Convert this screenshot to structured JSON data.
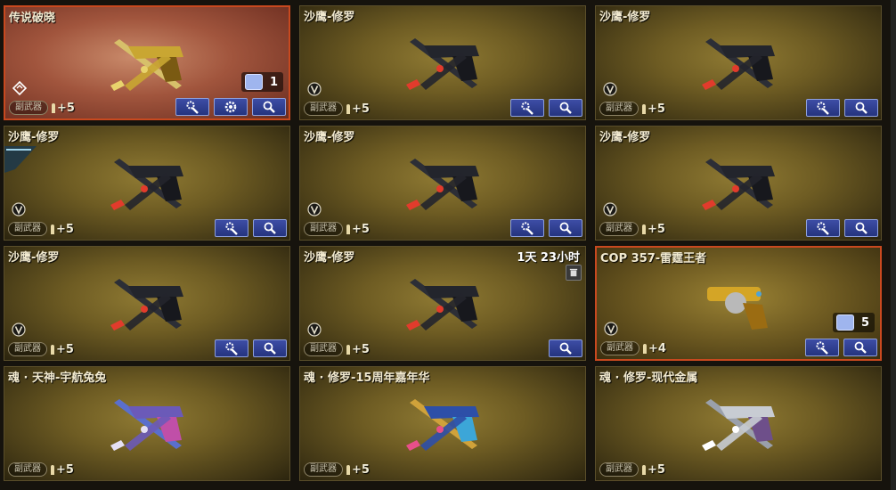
{
  "labels": {
    "category": "副武器"
  },
  "colors": {
    "rare_border": "#c8491f",
    "button_blue": "#3d4da5",
    "card_gold": "#8f7a33"
  },
  "icons": {
    "rank": "v-rank-icon",
    "upgrade": "wrench-gear-icon",
    "settings": "gear-icon",
    "inspect": "magnifier-icon"
  },
  "items": [
    {
      "name": "传说破晓",
      "ammo": "+5",
      "rare": true,
      "tint": "red",
      "rank": "diamond",
      "count": "1",
      "buttons": [
        "upgrade",
        "settings",
        "inspect"
      ],
      "weapon": "gold-eagle"
    },
    {
      "name": "沙鹰-修罗",
      "ammo": "+5",
      "rank": "v",
      "buttons": [
        "upgrade",
        "inspect"
      ],
      "weapon": "dark-eagle"
    },
    {
      "name": "沙鹰-修罗",
      "ammo": "+5",
      "rank": "v",
      "buttons": [
        "upgrade",
        "inspect"
      ],
      "weapon": "dark-eagle"
    },
    {
      "name": "沙鹰-修罗",
      "ammo": "+5",
      "rank": "v",
      "cfs": true,
      "buttons": [
        "upgrade",
        "inspect"
      ],
      "weapon": "dark-eagle"
    },
    {
      "name": "沙鹰-修罗",
      "ammo": "+5",
      "rank": "v",
      "buttons": [
        "upgrade",
        "inspect"
      ],
      "weapon": "dark-eagle"
    },
    {
      "name": "沙鹰-修罗",
      "ammo": "+5",
      "rank": "v",
      "buttons": [
        "upgrade",
        "inspect"
      ],
      "weapon": "dark-eagle"
    },
    {
      "name": "沙鹰-修罗",
      "ammo": "+5",
      "rank": "v",
      "buttons": [
        "upgrade",
        "inspect"
      ],
      "weapon": "dark-eagle"
    },
    {
      "name": "沙鹰-修罗",
      "ammo": "+5",
      "rank": "v",
      "timer": "1天 23小时",
      "trash": true,
      "buttons": [
        "inspect"
      ],
      "weapon": "dark-eagle"
    },
    {
      "name": "COP 357-雷霆王者",
      "ammo": "+4",
      "rare": true,
      "tint": "gold",
      "rank": "v",
      "count": "5",
      "buttons": [
        "upgrade",
        "inspect"
      ],
      "weapon": "gold-revolver"
    },
    {
      "name": "魂 · 天神-宇航兔兔",
      "ammo": "+5",
      "buttons": [],
      "weapon": "purple-eagle"
    },
    {
      "name": "魂 · 修罗-15周年嘉年华",
      "ammo": "+5",
      "buttons": [],
      "weapon": "blue-eagle"
    },
    {
      "name": "魂 · 修罗-现代金属",
      "ammo": "+5",
      "buttons": [],
      "weapon": "silver-eagle"
    }
  ]
}
